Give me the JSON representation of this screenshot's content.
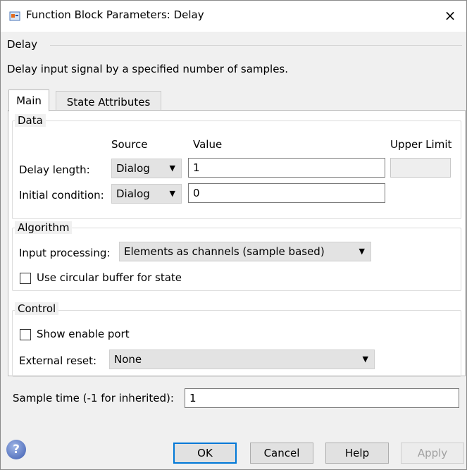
{
  "window": {
    "title": "Function Block Parameters: Delay",
    "close": "×"
  },
  "header": {
    "block_name": "Delay",
    "description": "Delay input signal by a specified number of samples."
  },
  "tabs": [
    {
      "label": "Main"
    },
    {
      "label": "State Attributes"
    }
  ],
  "data_group": {
    "legend": "Data",
    "col_source": "Source",
    "col_value": "Value",
    "col_upper": "Upper Limit",
    "rows": [
      {
        "label": "Delay length:",
        "source": "Dialog",
        "value": "1",
        "upper": ""
      },
      {
        "label": "Initial condition:",
        "source": "Dialog",
        "value": "0"
      }
    ]
  },
  "algorithm_group": {
    "legend": "Algorithm",
    "input_processing_label": "Input processing:",
    "input_processing_value": "Elements as channels (sample based)",
    "circular_buffer_label": "Use circular buffer for state",
    "circular_buffer_checked": false
  },
  "control_group": {
    "legend": "Control",
    "enable_port_label": "Show enable port",
    "enable_port_checked": false,
    "external_reset_label": "External reset:",
    "external_reset_value": "None"
  },
  "sample_time": {
    "label": "Sample time (-1 for inherited):",
    "value": "1"
  },
  "buttons": {
    "ok": "OK",
    "cancel": "Cancel",
    "help": "Help",
    "apply": "Apply",
    "help_icon": "?"
  },
  "icons": {
    "dropdown_arrow": "▼"
  }
}
